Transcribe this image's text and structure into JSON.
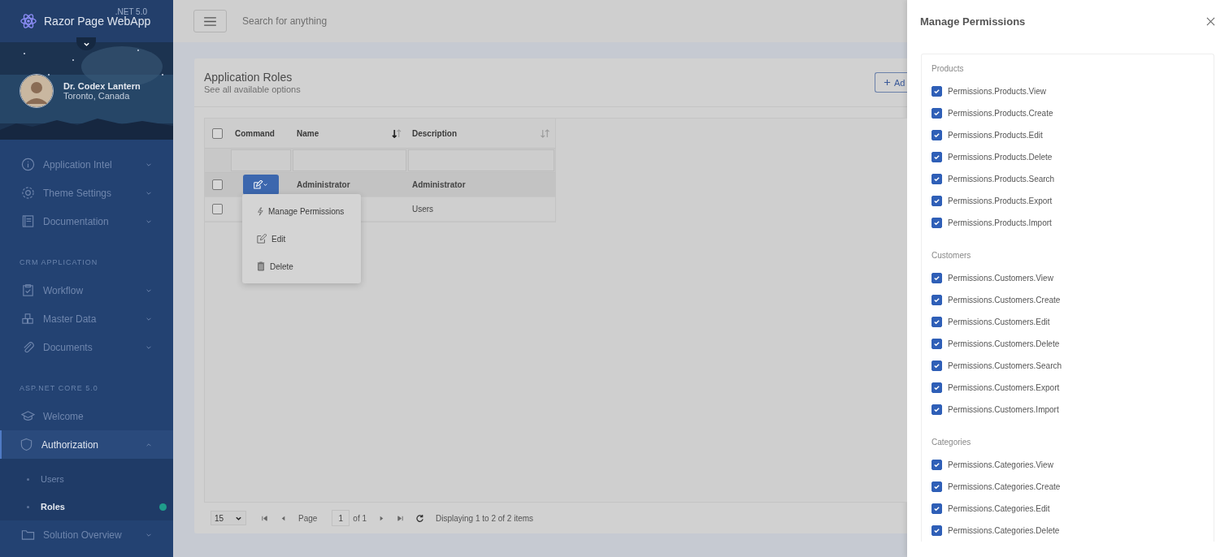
{
  "sidebar": {
    "app_title": "Razor Page WebApp",
    "version": ".NET 5.0",
    "profile": {
      "name": "Dr. Codex Lantern",
      "location": "Toronto, Canada"
    },
    "nav": [
      {
        "kind": "item",
        "label": "Application Intel",
        "selected": false,
        "expanded": false
      },
      {
        "kind": "item",
        "label": "Theme Settings",
        "selected": false,
        "expanded": false
      },
      {
        "kind": "item",
        "label": "Documentation",
        "selected": false,
        "expanded": false
      },
      {
        "kind": "heading",
        "label": "CRM APPLICATION"
      },
      {
        "kind": "item",
        "label": "Workflow",
        "selected": false,
        "expanded": false
      },
      {
        "kind": "item",
        "label": "Master Data",
        "selected": false,
        "expanded": false
      },
      {
        "kind": "item",
        "label": "Documents",
        "selected": false,
        "expanded": false
      },
      {
        "kind": "heading",
        "label": "ASP.NET CORE 5.0"
      },
      {
        "kind": "item",
        "label": "Welcome",
        "selected": false
      },
      {
        "kind": "item",
        "label": "Authorization",
        "selected": true,
        "expanded": true,
        "children": [
          {
            "label": "Users",
            "selected": false
          },
          {
            "label": "Roles",
            "selected": true
          }
        ]
      },
      {
        "kind": "item",
        "label": "Solution Overview",
        "selected": false,
        "expanded": false
      }
    ]
  },
  "topbar": {
    "search_placeholder": "Search for anything"
  },
  "card": {
    "title": "Application Roles",
    "subtitle": "See all available options",
    "add_button": "Ad"
  },
  "table": {
    "all_checked": false,
    "columns": [
      {
        "label": "Command"
      },
      {
        "label": "Name",
        "sorted": true
      },
      {
        "label": "Description",
        "sorted": false
      }
    ],
    "rows": [
      {
        "name": "Administrator",
        "description": "Administrator",
        "selected": true,
        "checked": false
      },
      {
        "description": "Users",
        "selected": false,
        "checked": false
      }
    ]
  },
  "command_menu": {
    "items": [
      {
        "label": "Manage Permissions"
      },
      {
        "label": "Edit"
      },
      {
        "label": "Delete"
      }
    ]
  },
  "pager": {
    "page_size": "15",
    "page_label": "Page",
    "page": "1",
    "page_count": "of 1",
    "status": "Displaying 1 to 2 of 2 items"
  },
  "drawer": {
    "title": "Manage Permissions",
    "groups": [
      {
        "name": "Products",
        "permissions": [
          {
            "label": "Permissions.Products.View",
            "checked": true
          },
          {
            "label": "Permissions.Products.Create",
            "checked": true
          },
          {
            "label": "Permissions.Products.Edit",
            "checked": true
          },
          {
            "label": "Permissions.Products.Delete",
            "checked": true
          },
          {
            "label": "Permissions.Products.Search",
            "checked": true
          },
          {
            "label": "Permissions.Products.Export",
            "checked": true
          },
          {
            "label": "Permissions.Products.Import",
            "checked": true
          }
        ]
      },
      {
        "name": "Customers",
        "permissions": [
          {
            "label": "Permissions.Customers.View",
            "checked": true
          },
          {
            "label": "Permissions.Customers.Create",
            "checked": true
          },
          {
            "label": "Permissions.Customers.Edit",
            "checked": true
          },
          {
            "label": "Permissions.Customers.Delete",
            "checked": true
          },
          {
            "label": "Permissions.Customers.Search",
            "checked": true
          },
          {
            "label": "Permissions.Customers.Export",
            "checked": true
          },
          {
            "label": "Permissions.Customers.Import",
            "checked": true
          }
        ]
      },
      {
        "name": "Categories",
        "permissions": [
          {
            "label": "Permissions.Categories.View",
            "checked": true
          },
          {
            "label": "Permissions.Categories.Create",
            "checked": true
          },
          {
            "label": "Permissions.Categories.Edit",
            "checked": true
          },
          {
            "label": "Permissions.Categories.Delete",
            "checked": true
          }
        ]
      }
    ]
  }
}
